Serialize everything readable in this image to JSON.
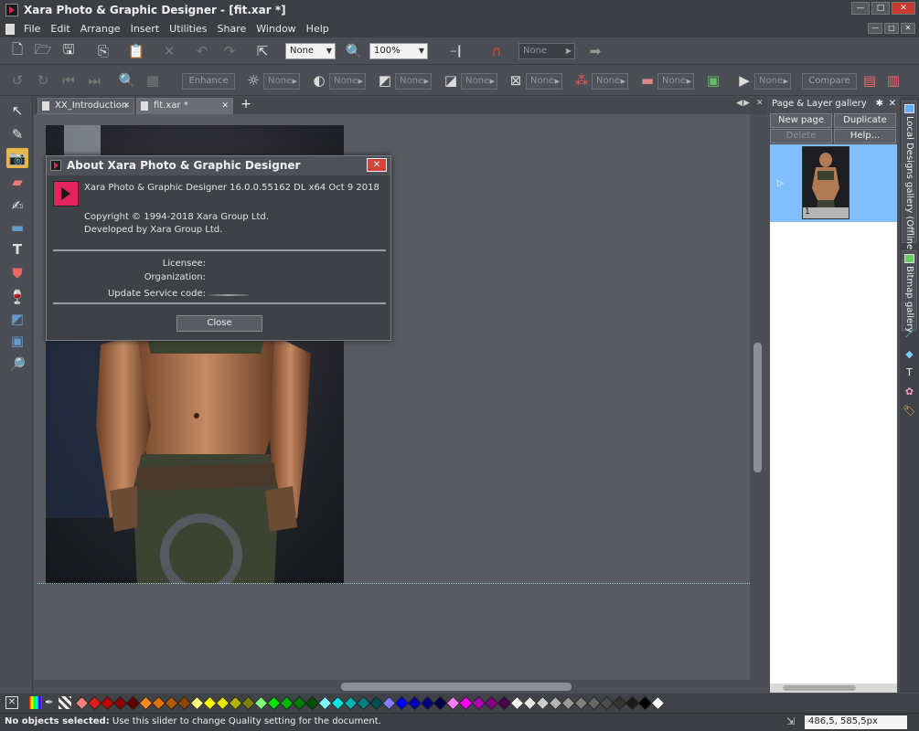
{
  "window": {
    "title": "Xara Photo & Graphic Designer - [fit.xar *]",
    "minimize": "—",
    "maximize": "□",
    "close": "✕"
  },
  "menu": {
    "items": [
      "File",
      "Edit",
      "Arrange",
      "Insert",
      "Utilities",
      "Share",
      "Window",
      "Help"
    ]
  },
  "toolbar1": {
    "quality_select": "None",
    "zoom_select": "100%",
    "right_select": "None"
  },
  "toolbar2": {
    "enhance_label": "Enhance",
    "compare_label": "Compare",
    "none_labels": [
      "None",
      "None",
      "None",
      "None",
      "None",
      "None",
      "None",
      "None"
    ]
  },
  "tabs": [
    {
      "label": "XX_Introduction",
      "close": "✕"
    },
    {
      "label": "fit.xar *",
      "close": "✕"
    }
  ],
  "tabs_add": "+",
  "gallery": {
    "title": "Page & Layer gallery",
    "new_page": "New page",
    "duplicate": "Duplicate",
    "delete": "Delete",
    "help": "Help...",
    "page_number": "1"
  },
  "side_tabs": {
    "local_designs": "Local Designs gallery (Offline)",
    "bitmap": "Bitmap gallery"
  },
  "about_dialog": {
    "title": "About Xara Photo & Graphic Designer",
    "version": "Xara Photo & Graphic Designer 16.0.0.55162  DL x64 Oct  9 2018",
    "copyright": "Copyright © 1994-2018 Xara Group Ltd.",
    "developer": "Developed by Xara Group Ltd.",
    "licensee_label": "Licensee:",
    "organization_label": "Organization:",
    "update_code_label": "Update Service code:",
    "close_button": "Close"
  },
  "status": {
    "bold": "No objects selected:",
    "text": " Use this slider to change Quality setting for the document.",
    "coords": "486,5, 585,5px"
  },
  "palette_colors": [
    "#f08080",
    "#e21b1b",
    "#c00000",
    "#8b0000",
    "#600000",
    "#ff8c1a",
    "#e07000",
    "#b35900",
    "#8b4500",
    "#ffff80",
    "#ffff00",
    "#e6e600",
    "#b3b300",
    "#808000",
    "#80ff80",
    "#00e600",
    "#00b300",
    "#008000",
    "#005000",
    "#80ffff",
    "#00e6e6",
    "#00b3b3",
    "#008080",
    "#004d4d",
    "#8080ff",
    "#0000ff",
    "#0000b3",
    "#000080",
    "#00004d",
    "#ff80ff",
    "#ff00ff",
    "#b300b3",
    "#800080",
    "#4d004d",
    "#ffffff",
    "#e6e6e6",
    "#cccccc",
    "#b3b3b3",
    "#999999",
    "#808080",
    "#666666",
    "#4d4d4d",
    "#333333",
    "#1a1a1a",
    "#000000",
    "#ffffff"
  ]
}
